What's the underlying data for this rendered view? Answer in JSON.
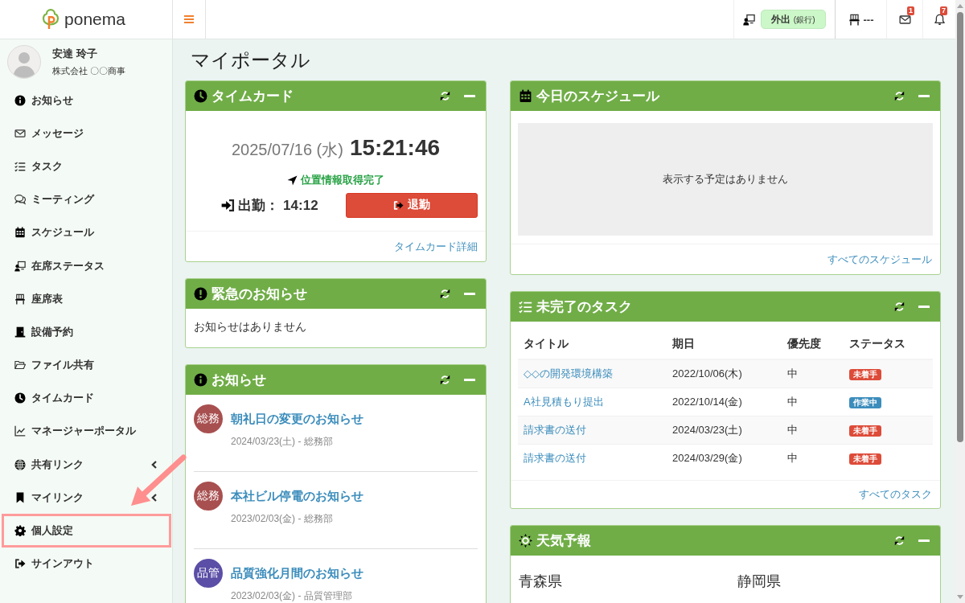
{
  "header": {
    "logo": "ponema",
    "status": {
      "label": "外出",
      "detail": "(銀行)"
    },
    "seat": "---",
    "mail_count": "1",
    "notification_count": "7"
  },
  "user": {
    "name": "安達 玲子",
    "company": "株式会社 〇〇商事"
  },
  "sidebar": {
    "items": [
      {
        "label": "お知らせ",
        "has_submenu": false,
        "highlighted": false
      },
      {
        "label": "メッセージ",
        "has_submenu": false,
        "highlighted": false
      },
      {
        "label": "タスク",
        "has_submenu": false,
        "highlighted": false
      },
      {
        "label": "ミーティング",
        "has_submenu": false,
        "highlighted": false
      },
      {
        "label": "スケジュール",
        "has_submenu": false,
        "highlighted": false
      },
      {
        "label": "在席ステータス",
        "has_submenu": false,
        "highlighted": false
      },
      {
        "label": "座席表",
        "has_submenu": false,
        "highlighted": false
      },
      {
        "label": "設備予約",
        "has_submenu": false,
        "highlighted": false
      },
      {
        "label": "ファイル共有",
        "has_submenu": false,
        "highlighted": false
      },
      {
        "label": "タイムカード",
        "has_submenu": false,
        "highlighted": false
      },
      {
        "label": "マネージャーポータル",
        "has_submenu": false,
        "highlighted": false
      },
      {
        "label": "共有リンク",
        "has_submenu": true,
        "highlighted": false
      },
      {
        "label": "マイリンク",
        "has_submenu": true,
        "highlighted": false
      },
      {
        "label": "個人設定",
        "has_submenu": false,
        "highlighted": true
      },
      {
        "label": "サインアウト",
        "has_submenu": false,
        "highlighted": false
      }
    ]
  },
  "page_title": "マイポータル",
  "timecard": {
    "title": "タイムカード",
    "date": "2025/07/16 (水)",
    "time": "15:21:46",
    "location": "位置情報取得完了",
    "clock_in": "出勤： 14:12",
    "clock_out_button": "退勤",
    "detail_link": "タイムカード詳細"
  },
  "emergency": {
    "title": "緊急のお知らせ",
    "empty_text": "お知らせはありません"
  },
  "notices": {
    "title": "お知らせ",
    "items": [
      {
        "department": "総務",
        "color": "#a84f4f",
        "title": "朝礼日の変更のお知らせ",
        "meta": "2024/03/23(土) - 総務部"
      },
      {
        "department": "総務",
        "color": "#a84f4f",
        "title": "本社ビル停電のお知らせ",
        "meta": "2023/02/03(金) - 総務部"
      },
      {
        "department": "品管",
        "color": "#5a4ea6",
        "title": "品質強化月間のお知らせ",
        "meta": "2023/02/03(金) - 品質管理部"
      }
    ]
  },
  "schedule": {
    "title": "今日のスケジュール",
    "empty_text": "表示する予定はありません",
    "link": "すべてのスケジュール"
  },
  "tasks": {
    "title": "未完了のタスク",
    "columns": [
      "タイトル",
      "期日",
      "優先度",
      "ステータス"
    ],
    "rows": [
      {
        "title": "◇◇の開発環境構築",
        "due": "2022/10/06(木)",
        "priority": "中",
        "status": "未着手",
        "color": "#dd4b39"
      },
      {
        "title": "A社見積もり提出",
        "due": "2022/10/14(金)",
        "priority": "中",
        "status": "作業中",
        "color": "#3c8dbc"
      },
      {
        "title": "請求書の送付",
        "due": "2024/03/23(土)",
        "priority": "中",
        "status": "未着手",
        "color": "#dd4b39"
      },
      {
        "title": "請求書の送付",
        "due": "2024/03/29(金)",
        "priority": "中",
        "status": "未着手",
        "color": "#dd4b39"
      }
    ],
    "link": "すべてのタスク"
  },
  "weather": {
    "title": "天気予報",
    "regions": [
      "青森県",
      "静岡県"
    ]
  }
}
